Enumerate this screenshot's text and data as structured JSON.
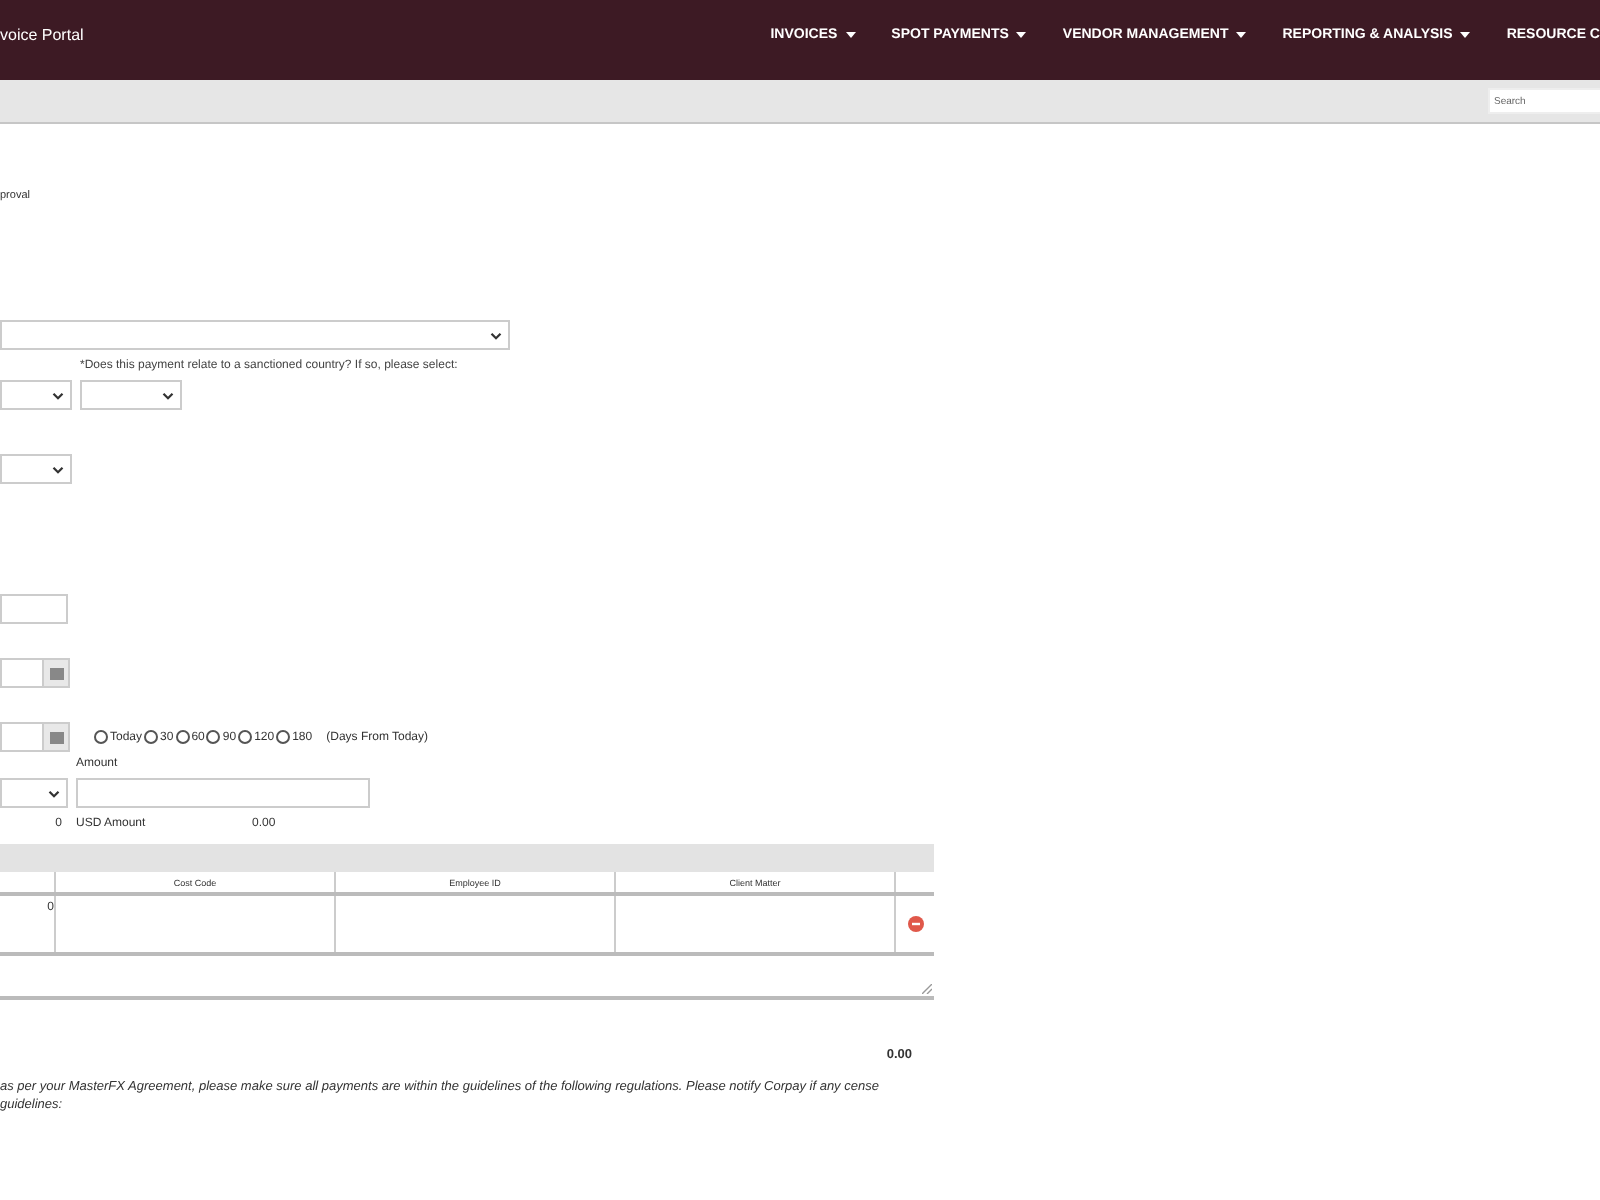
{
  "header": {
    "brand": "voice Portal",
    "nav": [
      {
        "label": "INVOICES",
        "has_menu": true
      },
      {
        "label": "SPOT PAYMENTS",
        "has_menu": true
      },
      {
        "label": "VENDOR MANAGEMENT",
        "has_menu": true
      },
      {
        "label": "REPORTING & ANALYSIS",
        "has_menu": true
      },
      {
        "label": "RESOURCE C",
        "has_menu": false
      }
    ]
  },
  "search": {
    "placeholder": "Search"
  },
  "form": {
    "note": "proval",
    "sanction_label": "*Does this payment relate to a sanctioned country? If so, please select:",
    "date_options": [
      {
        "label": "Today",
        "selected": false
      },
      {
        "label": "30",
        "selected": false
      },
      {
        "label": "60",
        "selected": false
      },
      {
        "label": "90",
        "selected": false
      },
      {
        "label": "120",
        "selected": false
      },
      {
        "label": "180",
        "selected": false
      }
    ],
    "days_hint": "(Days From Today)",
    "amount_label": "Amount",
    "count": "0",
    "usd_label": "USD Amount",
    "usd_value": "0.00"
  },
  "allocation_table": {
    "columns": [
      "Cost Code",
      "Employee ID",
      "Client Matter"
    ],
    "rows": [
      {
        "column_1": "0"
      }
    ]
  },
  "total": "0.00",
  "disclaimer": "as per your MasterFX Agreement, please make sure all payments are within the guidelines of the following regulations. Please notify Corpay if any cense guidelines:"
}
